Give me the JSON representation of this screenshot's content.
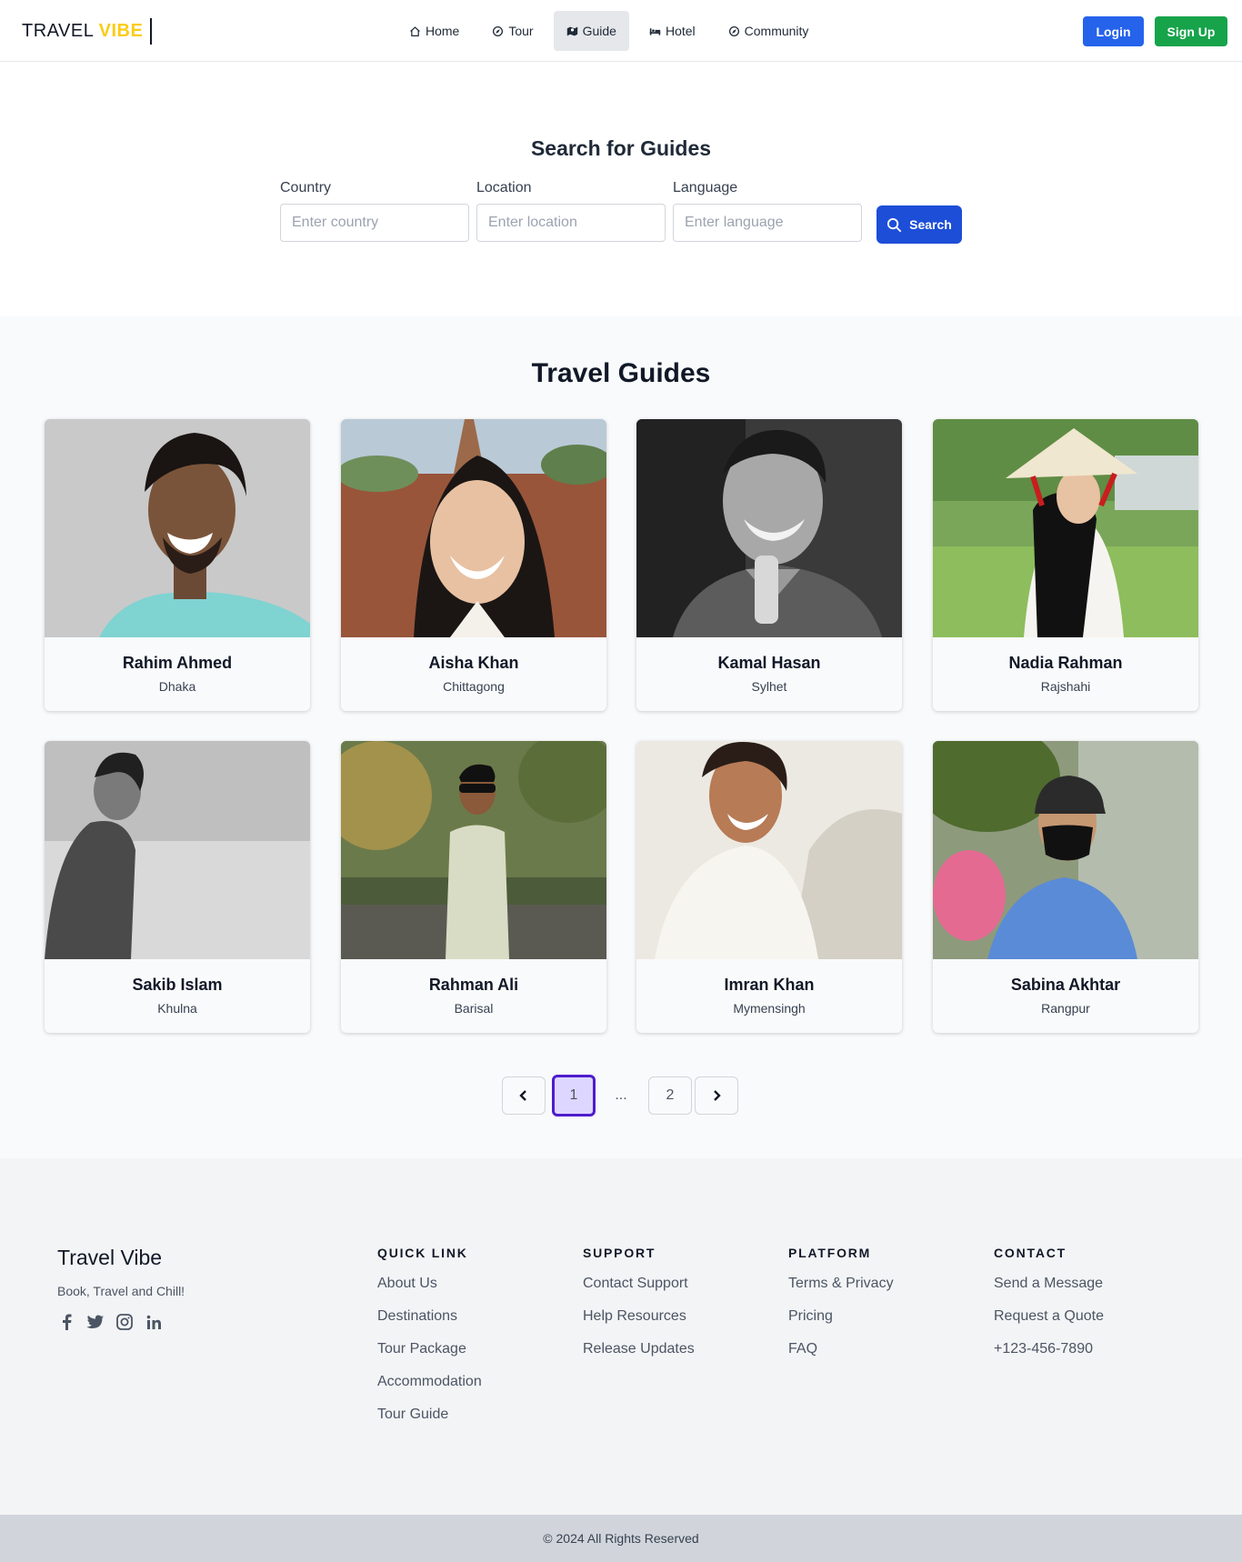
{
  "nav": {
    "logo_part1": "TRAVEL",
    "logo_part2": "VIBE",
    "links": [
      {
        "label": "Home",
        "icon": "home-icon"
      },
      {
        "label": "Tour",
        "icon": "compass-icon"
      },
      {
        "label": "Guide",
        "icon": "map-icon",
        "active": true
      },
      {
        "label": "Hotel",
        "icon": "bed-icon"
      },
      {
        "label": "Community",
        "icon": "compass-icon"
      }
    ],
    "login": "Login",
    "signup": "Sign Up"
  },
  "search": {
    "title": "Search for Guides",
    "country_label": "Country",
    "country_placeholder": "Enter country",
    "location_label": "Location",
    "location_placeholder": "Enter location",
    "language_label": "Language",
    "language_placeholder": "Enter language",
    "button": "Search"
  },
  "guides": {
    "title": "Travel Guides",
    "items": [
      {
        "name": "Rahim Ahmed",
        "city": "Dhaka"
      },
      {
        "name": "Aisha Khan",
        "city": "Chittagong"
      },
      {
        "name": "Kamal Hasan",
        "city": "Sylhet"
      },
      {
        "name": "Nadia Rahman",
        "city": "Rajshahi"
      },
      {
        "name": "Sakib Islam",
        "city": "Khulna"
      },
      {
        "name": "Rahman Ali",
        "city": "Barisal"
      },
      {
        "name": "Imran Khan",
        "city": "Mymensingh"
      },
      {
        "name": "Sabina Akhtar",
        "city": "Rangpur"
      }
    ]
  },
  "pagination": {
    "current": "1",
    "dots": "...",
    "next_page": "2"
  },
  "footer": {
    "brand": "Travel Vibe",
    "tagline": "Book, Travel and Chill!",
    "social": [
      "facebook-icon",
      "twitter-icon",
      "instagram-icon",
      "linkedin-icon"
    ],
    "columns": [
      {
        "title": "QUICK LINK",
        "links": [
          "About Us",
          "Destinations",
          "Tour Package",
          "Accommodation",
          "Tour Guide"
        ]
      },
      {
        "title": "SUPPORT",
        "links": [
          "Contact Support",
          "Help Resources",
          "Release Updates"
        ]
      },
      {
        "title": "PLATFORM",
        "links": [
          "Terms & Privacy",
          "Pricing",
          "FAQ"
        ]
      },
      {
        "title": "CONTACT",
        "links": [
          "Send a Message",
          "Request a Quote",
          "+123-456-7890"
        ]
      }
    ],
    "copyright": "© 2024 All Rights Reserved"
  },
  "colors": {
    "primary": "#2563eb",
    "search_button": "#1d4ed8",
    "signup": "#16a34a",
    "logo_accent": "#facc15",
    "active_page_border": "#4f1ccd",
    "active_page_fill": "#ddd6fe"
  }
}
